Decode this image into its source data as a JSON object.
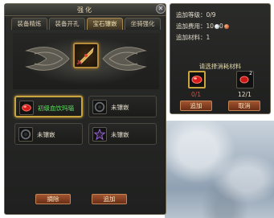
{
  "main": {
    "title": "强化",
    "close_glyph": "✕",
    "tabs": [
      {
        "label": "装备精炼",
        "active": false
      },
      {
        "label": "装备开孔",
        "active": false
      },
      {
        "label": "宝石镶嵌",
        "active": true
      },
      {
        "label": "坐骑强化",
        "active": false
      }
    ],
    "center_item_icon": "sword-icon",
    "slots": [
      {
        "label": "初级血饮玛瑙",
        "icon": "red-gem-icon",
        "state": "selected"
      },
      {
        "label": "未镶嵌",
        "icon": "empty-socket-icon",
        "state": "empty"
      },
      {
        "label": "未镶嵌",
        "icon": "empty-socket-icon",
        "state": "empty"
      },
      {
        "label": "未镶嵌",
        "icon": "purple-star-socket-icon",
        "state": "empty"
      }
    ],
    "remove_label": "摘除",
    "add_label": "追加"
  },
  "side": {
    "level_label": "追加等级：",
    "level_value": "0/9",
    "fee_label": "追加费用：",
    "fee_silver": "10",
    "fee_copper": "0",
    "material_label": "追加材料：",
    "material_value": "1",
    "heading": "请选择消耗材料",
    "materials": [
      {
        "icon": "red-gem-icon",
        "count": "0/1",
        "count_color": "#e04a3a"
      },
      {
        "icon": "red-gem-icon",
        "count": "12/1",
        "count_color": "#e8e0cf",
        "badge": "2"
      }
    ],
    "add_label": "追加",
    "cancel_label": "取消"
  },
  "colors": {
    "accent_gold": "#c9a43e",
    "button_red": "#a2542f",
    "gem_name_green": "#5ee55e"
  }
}
